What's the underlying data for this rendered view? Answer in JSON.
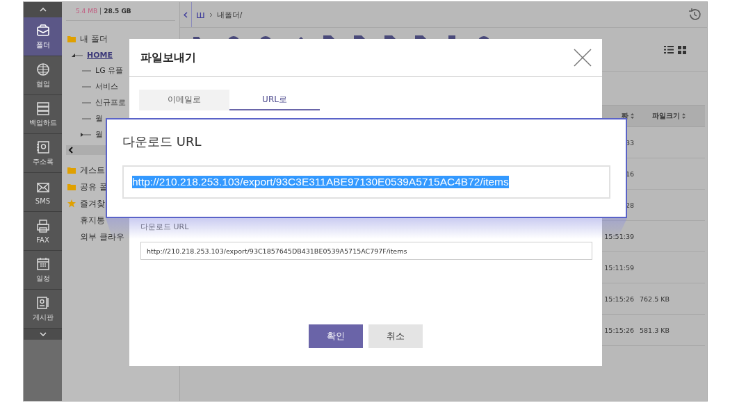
{
  "nav": {
    "items": [
      {
        "label": "폴더",
        "selected": true
      },
      {
        "label": "협업",
        "selected": false
      },
      {
        "label": "백업하드",
        "selected": false
      },
      {
        "label": "주소록",
        "selected": false
      },
      {
        "label": "SMS",
        "selected": false
      },
      {
        "label": "FAX",
        "selected": false
      },
      {
        "label": "일정",
        "selected": false
      },
      {
        "label": "게시판",
        "selected": false
      }
    ]
  },
  "sidebar": {
    "usage": {
      "used": "5.4 MB",
      "total": "28.5 GB"
    },
    "tree": [
      {
        "label": "내 폴더",
        "kind": "folder",
        "children": [
          {
            "label": "HOME",
            "selected": true,
            "expanded": true,
            "children": [
              {
                "label": "LG 유플",
                "kind": "leaf"
              },
              {
                "label": "서비스",
                "kind": "leaf"
              },
              {
                "label": "신규프로",
                "kind": "leaf"
              },
              {
                "label": "월",
                "kind": "leaf"
              },
              {
                "label": "월",
                "kind": "branch",
                "expanded": false
              }
            ]
          }
        ]
      },
      {
        "label": "게스트",
        "kind": "folder"
      },
      {
        "label": "공유 폴",
        "kind": "folder"
      },
      {
        "label": "즐겨찾",
        "kind": "star"
      },
      {
        "label": "휴지통",
        "kind": "plain"
      },
      {
        "label": "외부 클라우",
        "kind": "plain"
      }
    ]
  },
  "breadcrumb": [
    "ш",
    "내폴더/"
  ],
  "table": {
    "columns": [
      "짜",
      "파일크기"
    ],
    "rows": [
      {
        "date": "33"
      },
      {
        "date": "16"
      },
      {
        "date": "28"
      },
      {
        "date": "15:51:39"
      },
      {
        "date": "15:11:59"
      },
      {
        "date": "15:15:26",
        "size": "762.5 KB"
      },
      {
        "date": "15:15:26",
        "size": "581.3 KB"
      }
    ]
  },
  "dialog": {
    "title": "파일보내기",
    "tabs": [
      {
        "label": "이메일로",
        "selected": false
      },
      {
        "label": "URL로",
        "selected": true
      }
    ],
    "url_label": "다운로드 URL",
    "url_value": "http://210.218.253.103/export/93C1857645DB431BE0539A5715AC797F/items",
    "buttons": [
      {
        "label": "확인",
        "kind": "primary"
      },
      {
        "label": "취소",
        "kind": "secondary"
      }
    ]
  },
  "callout": {
    "label": "다운로드 URL",
    "url_value": "http://210.218.253.103/export/93C3E311ABE97130E0539A5715AC4B72/items",
    "url_selected": true
  }
}
